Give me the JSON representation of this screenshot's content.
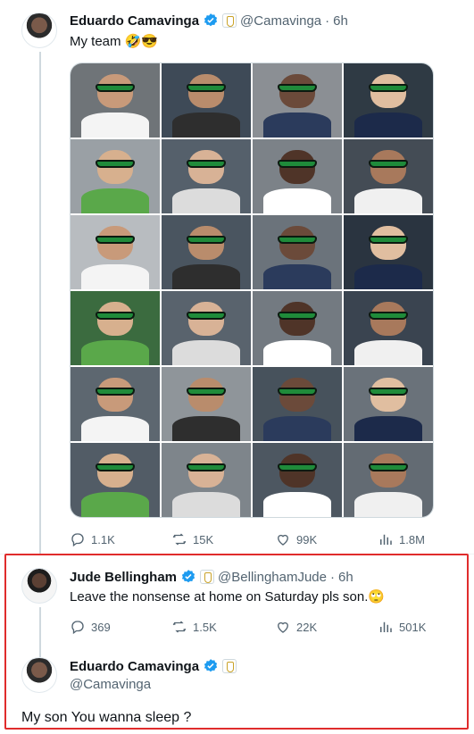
{
  "tweet1": {
    "author_name": "Eduardo Camavinga",
    "handle": "@Camavinga",
    "time": "6h",
    "text": "My team 🤣😎",
    "stats": {
      "replies": "1.1K",
      "retweets": "15K",
      "likes": "99K",
      "views": "1.8M"
    }
  },
  "reply1": {
    "author_name": "Jude Bellingham",
    "handle": "@BellinghamJude",
    "time": "6h",
    "text": "Leave the nonsense at home on Saturday pls son.🙄",
    "stats": {
      "replies": "369",
      "retweets": "1.5K",
      "likes": "22K",
      "views": "501K"
    }
  },
  "reply2": {
    "author_name": "Eduardo Camavinga",
    "handle": "@Camavinga",
    "text": "My son You wanna sleep ?"
  },
  "colors": {
    "accent": "#1d9bf0",
    "highlight": "#e02c2c",
    "muted": "#536471",
    "shades": "#1f8b3a"
  },
  "icons": [
    "verified-badge-icon",
    "real-madrid-crest-icon",
    "reply-icon",
    "retweet-icon",
    "like-icon",
    "views-icon"
  ]
}
